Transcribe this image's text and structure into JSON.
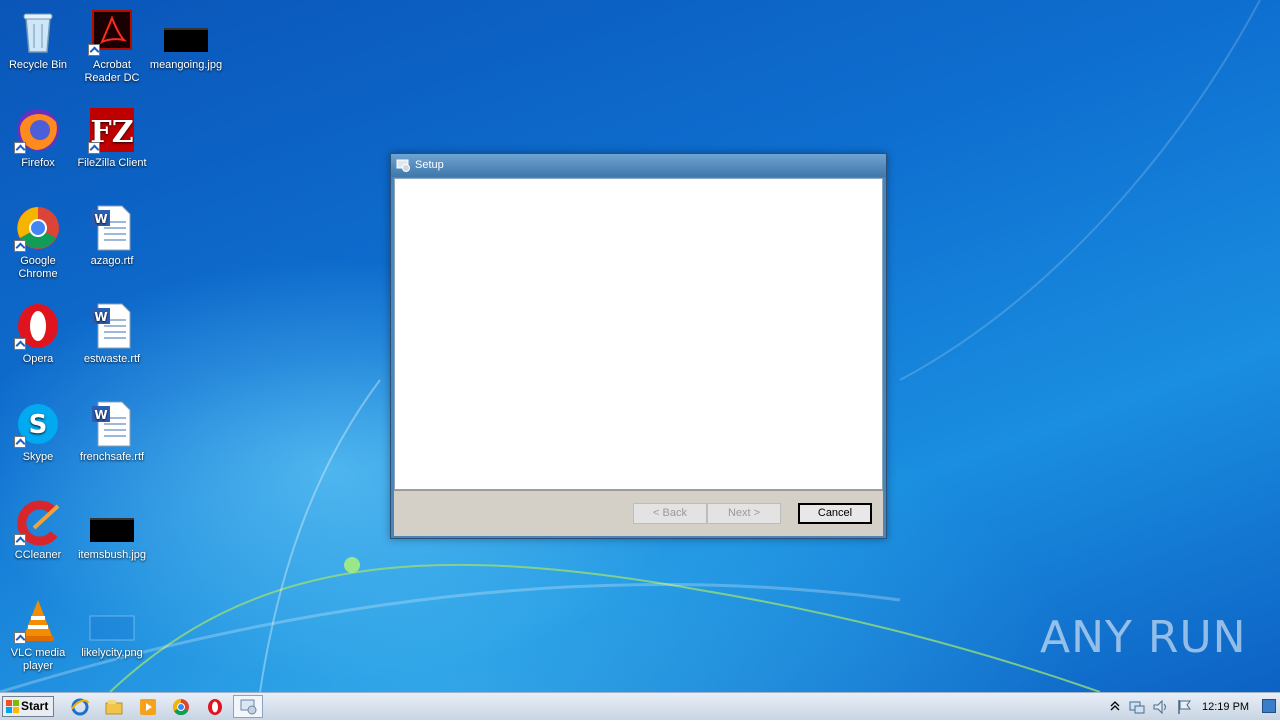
{
  "desktop_icons": [
    {
      "label": "Recycle Bin",
      "icon": "recycle-bin-icon"
    },
    {
      "label": "Acrobat Reader DC",
      "icon": "acrobat-icon"
    },
    {
      "label": "meangoing.jpg",
      "icon": "image-file-icon"
    },
    {
      "label": "Firefox",
      "icon": "firefox-icon"
    },
    {
      "label": "FileZilla Client",
      "icon": "filezilla-icon"
    },
    {
      "label": "Google Chrome",
      "icon": "chrome-icon"
    },
    {
      "label": "azago.rtf",
      "icon": "word-document-icon"
    },
    {
      "label": "Opera",
      "icon": "opera-icon"
    },
    {
      "label": "estwaste.rtf",
      "icon": "word-document-icon"
    },
    {
      "label": "Skype",
      "icon": "skype-icon"
    },
    {
      "label": "frenchsafe.rtf",
      "icon": "word-document-icon"
    },
    {
      "label": "CCleaner",
      "icon": "ccleaner-icon"
    },
    {
      "label": "itemsbush.jpg",
      "icon": "image-file-icon"
    },
    {
      "label": "VLC media player",
      "icon": "vlc-icon"
    },
    {
      "label": "likelycity.png",
      "icon": "image-file-icon"
    }
  ],
  "setup_window": {
    "title": "Setup",
    "back_label": "< Back",
    "next_label": "Next >",
    "cancel_label": "Cancel"
  },
  "taskbar": {
    "start_label": "Start",
    "clock": "12:19 PM",
    "pinned": [
      "internet-explorer-icon",
      "file-explorer-icon",
      "media-player-icon",
      "chrome-icon",
      "opera-icon",
      "setup-app-icon"
    ]
  },
  "watermark": "ANY RUN",
  "colors": {
    "desktop_blue": "#0e6fd0",
    "window_frame": "#4c86b8",
    "footer_gray": "#d4d0c8"
  }
}
